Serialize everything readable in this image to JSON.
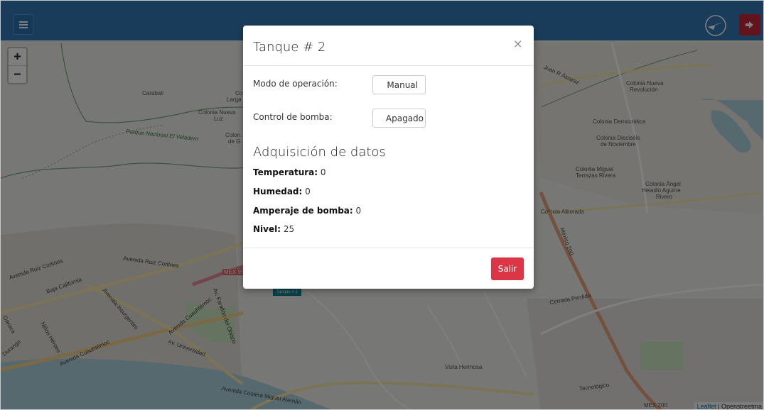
{
  "topbar": {
    "menu_icon": "hamburger-icon",
    "compass_icon": "compass-icon",
    "logout_icon": "sign-out-icon",
    "brand_color": "#3478b6",
    "logout_color": "#c5283a"
  },
  "zoom": {
    "in_label": "+",
    "out_label": "−"
  },
  "map": {
    "labels": {
      "caraball": "Carabalí",
      "colonia_nueva_luz_1": "Colonia Nueva",
      "colonia_nueva_luz_2": "Luz",
      "parque": "Parque Nacional El Veladero",
      "largo_partial": "Co",
      "largo_partial2": "Larga",
      "colon_partial": "Colon",
      "colon_partial2": "de G",
      "juan_alvarez": "Juan R Álvarez",
      "colonia_nueva_rev_1": "Colonia Nueva",
      "colonia_nueva_rev_2": "Revolución",
      "colonia_democratica": "Colonia Democrática",
      "dieciseis_1": "Colonia Dieciséis",
      "dieciseis_2": "de Noviembre",
      "miguel_1": "Colonia Miguel",
      "miguel_2": "Terrazas Rivera",
      "angel_1": "Colonia Ángel",
      "angel_2": "Heladio Aguirre",
      "angel_3": "Rivero",
      "alborada": "Colonia Alborada",
      "mex200": "México 200",
      "ruiz_cortines_1": "Avenida Ruiz Cortines",
      "ruiz_cortines_2": "Avenida Ruiz Cortines",
      "mex95": "MEX 95",
      "baja_california": "Baja California",
      "cerrada_perdida": "Cerrada Perdida",
      "av_insurgentes": "Avenida Insurgentes",
      "av_cuauhtemoc": "Avenida Cuauhtémoc",
      "av_farallon": "Av. Farallón del Obispo",
      "av_universidad": "Av. Universidad",
      "av_cuauhtemoc_2": "Avenida Cuauhtémoc",
      "vista_hermosa": "Vista Hermosa",
      "costera": "Avenida Costera Miguel Alemán",
      "tecnologico": "Tecnológico",
      "mex200_b": "MEX 200",
      "durango": "Durango",
      "oaxaca": "Oaxaca",
      "nino_heroes": "Niños Héroes"
    },
    "marker_label": "Tanque # 2",
    "attribution_link": "Leaflet",
    "attribution_rest": " | Openstreetma"
  },
  "modal": {
    "title": "Tanque # 2",
    "close_label": "×",
    "operation_mode_label": "Modo de operación:",
    "operation_mode_value": "Manual",
    "pump_control_label": "Control de bomba:",
    "pump_control_value": "Apagado",
    "section_title": "Adquisición de datos",
    "readings": [
      {
        "label": "Temperatura:",
        "value": "0"
      },
      {
        "label": "Humedad:",
        "value": "0"
      },
      {
        "label": "Amperaje de bomba:",
        "value": "0"
      },
      {
        "label": "Nivel:",
        "value": "25"
      }
    ],
    "exit_label": "Salir",
    "exit_color": "#dc3545"
  }
}
